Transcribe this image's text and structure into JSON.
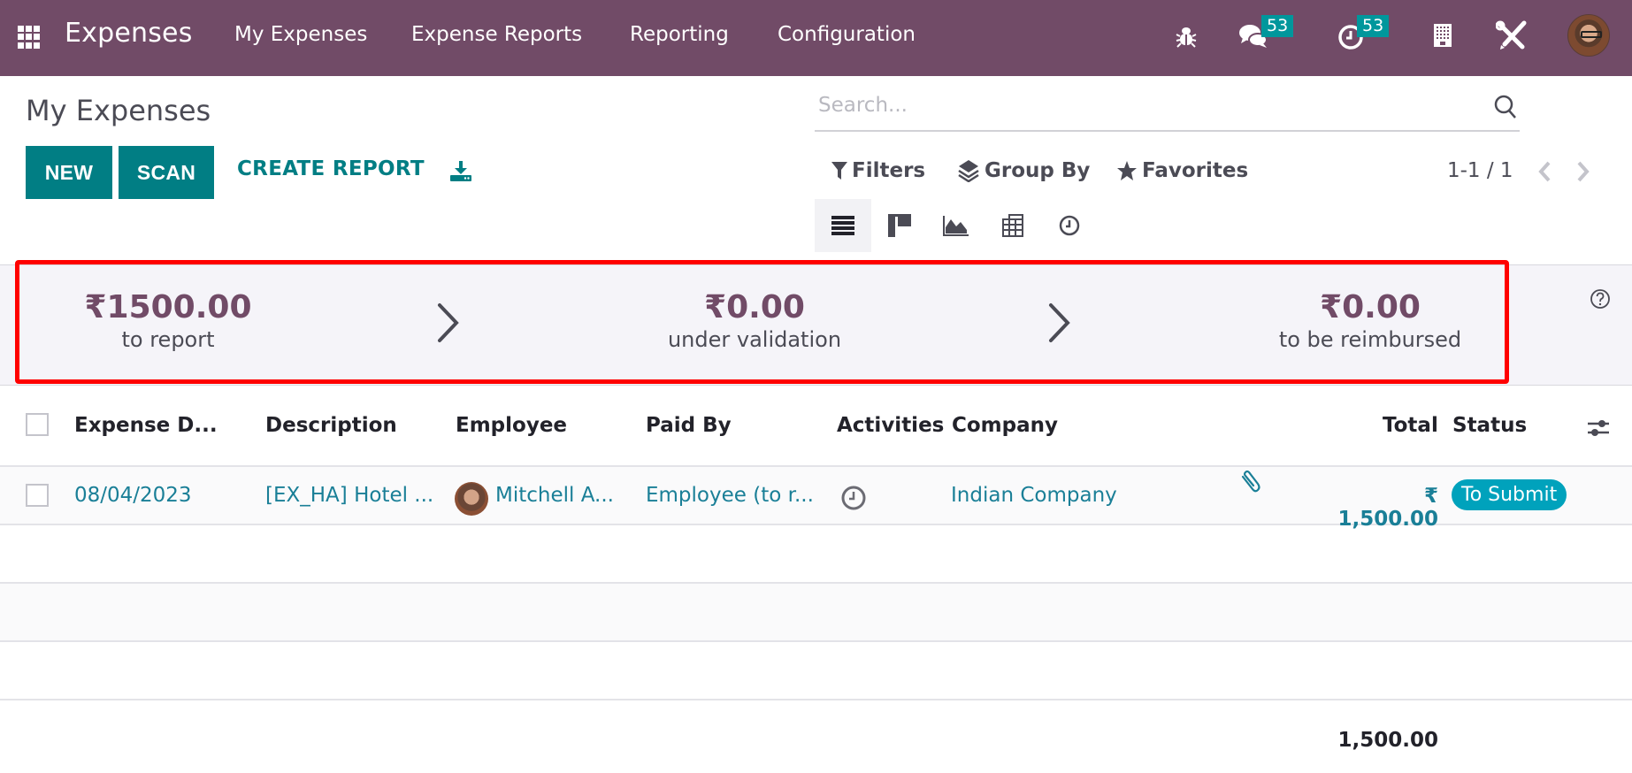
{
  "navbar": {
    "app_name": "Expenses",
    "menu": [
      "My Expenses",
      "Expense Reports",
      "Reporting",
      "Configuration"
    ],
    "messages_count": "53",
    "activities_count": "53",
    "icons": [
      "apps-icon",
      "bug-icon",
      "chat-icon",
      "clock-icon",
      "building-icon",
      "tools-icon",
      "user-avatar"
    ]
  },
  "control_panel": {
    "title": "My Expenses",
    "buttons": {
      "new": "NEW",
      "scan": "SCAN",
      "create_report": "CREATE REPORT"
    },
    "search_placeholder": "Search...",
    "search_value": "",
    "filters_label": "Filters",
    "groupby_label": "Group By",
    "favorites_label": "Favorites",
    "pager": "1-1 / 1",
    "views": [
      "list",
      "kanban",
      "graph",
      "pivot",
      "activity"
    ],
    "active_view": "list"
  },
  "summary": {
    "items": [
      {
        "amount": "₹1500.00",
        "label": "to report"
      },
      {
        "amount": "₹0.00",
        "label": "under validation"
      },
      {
        "amount": "₹0.00",
        "label": "to be reimbursed"
      }
    ]
  },
  "table": {
    "columns": [
      "Expense D...",
      "Description",
      "Employee",
      "Paid By",
      "Activities",
      "Company",
      "Total",
      "Status"
    ],
    "rows": [
      {
        "date": "08/04/2023",
        "description": "[EX_HA] Hotel ...",
        "employee": "Mitchell A...",
        "paid_by": "Employee (to r...",
        "company": "Indian Company",
        "total": "₹ 1,500.00",
        "status": "To Submit",
        "has_attachment": true
      }
    ],
    "grand_total": "1,500.00"
  },
  "colors": {
    "brand": "#714B67",
    "primary": "#017e84",
    "badge": "#00979c",
    "status_badge": "#00a2bc",
    "highlight": "#ff0000"
  }
}
